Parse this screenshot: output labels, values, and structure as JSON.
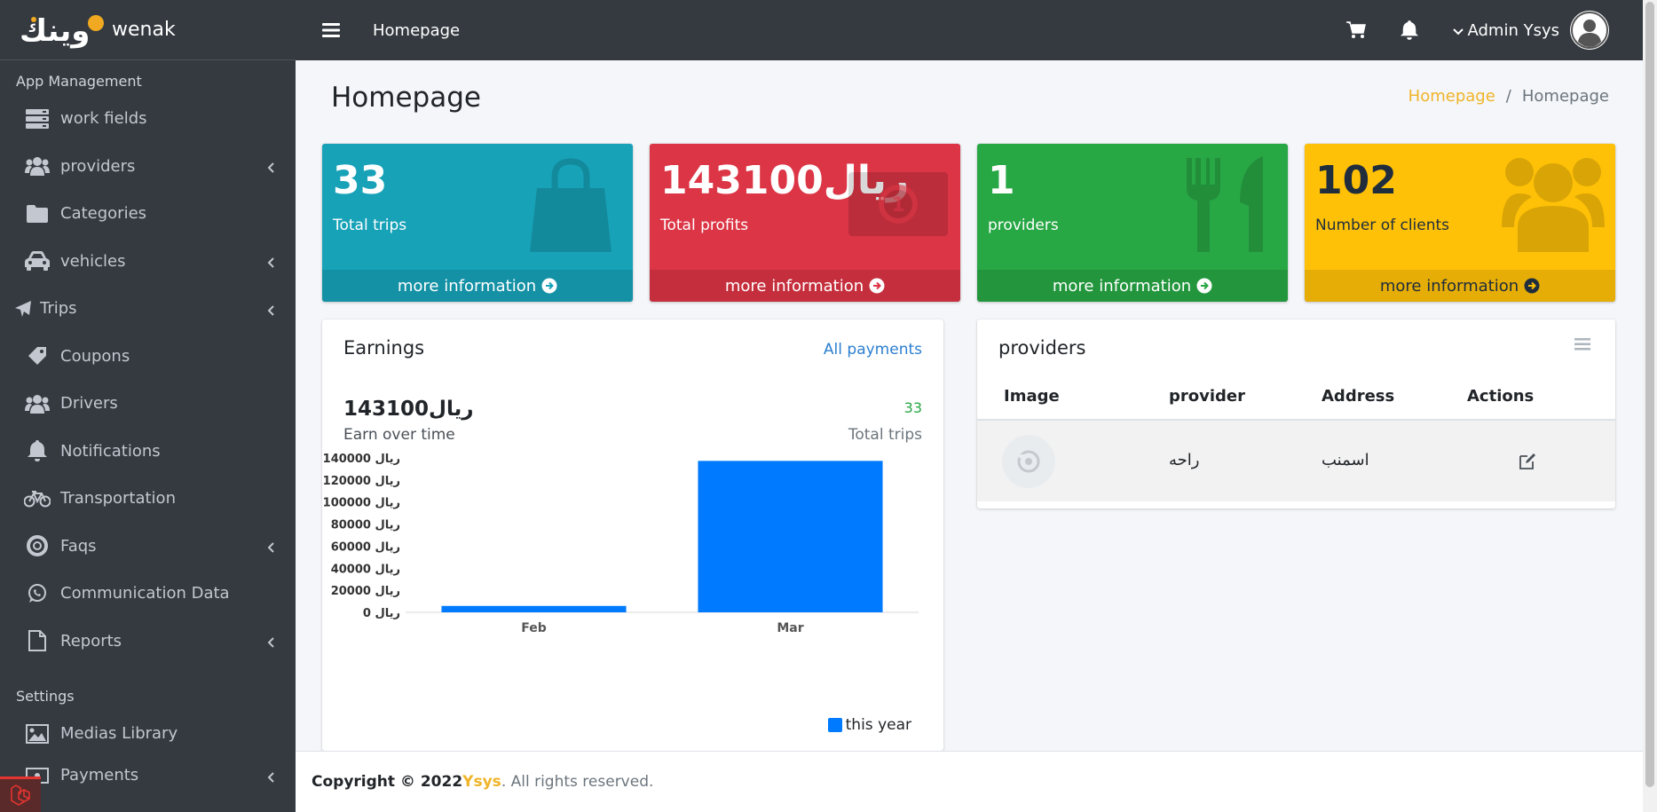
{
  "brand": {
    "logo_text": "وينك",
    "name": "wenak"
  },
  "sidebar": {
    "app_header": "App Management",
    "items": [
      {
        "label": "work fields",
        "icon": "server-icon",
        "has_caret": false
      },
      {
        "label": "providers",
        "icon": "users-icon",
        "has_caret": true
      },
      {
        "label": "Categories",
        "icon": "folder-icon",
        "has_caret": false
      },
      {
        "label": "vehicles",
        "icon": "car-icon",
        "has_caret": true
      },
      {
        "label": "Trips",
        "icon": "plane-icon",
        "has_caret": true
      },
      {
        "label": "Coupons",
        "icon": "ticket-icon",
        "has_caret": false
      },
      {
        "label": "Drivers",
        "icon": "users-icon",
        "has_caret": false
      },
      {
        "label": "Notifications",
        "icon": "bell-icon",
        "has_caret": false
      },
      {
        "label": "Transportation",
        "icon": "bicycle-icon",
        "has_caret": false
      },
      {
        "label": "Faqs",
        "icon": "life-ring-icon",
        "has_caret": true
      },
      {
        "label": "Communication Data",
        "icon": "whatsapp-icon",
        "has_caret": false
      },
      {
        "label": "Reports",
        "icon": "file-icon",
        "has_caret": true
      }
    ],
    "settings_header": "Settings",
    "settings_items": [
      {
        "label": "Medias Library",
        "icon": "image-icon",
        "has_caret": false
      },
      {
        "label": "Payments",
        "icon": "money-icon",
        "has_caret": true
      }
    ]
  },
  "topbar": {
    "title": "Homepage",
    "user_name": "Admin Ysys"
  },
  "page": {
    "title": "Homepage",
    "breadcrumb": {
      "link": "Homepage",
      "current": "Homepage"
    }
  },
  "stats": [
    {
      "value": "33",
      "label": "Total trips",
      "footer": "more information",
      "color": "#17a2b8",
      "icon": "shopping-bag-icon"
    },
    {
      "value": "143100ريال",
      "label": "Total profits",
      "footer": "more information",
      "color": "#dc3545",
      "icon": "money-bill-icon"
    },
    {
      "value": "1",
      "label": "providers",
      "footer": "more information",
      "color": "#28a745",
      "icon": "utensils-icon"
    },
    {
      "value": "102",
      "label": "Number of clients",
      "footer": "more information",
      "color": "#ffc107",
      "icon": "users-icon"
    }
  ],
  "earnings": {
    "title": "Earnings",
    "link": "All payments",
    "total": "143100ريال",
    "subtitle": "Earn over time",
    "trips_count": "33",
    "trips_label": "Total trips",
    "legend": "this year"
  },
  "chart_data": {
    "type": "bar",
    "categories": [
      "Feb",
      "Mar"
    ],
    "series": [
      {
        "name": "this year",
        "values": [
          5800,
          137300
        ],
        "color": "#007bff"
      }
    ],
    "y_ticks": [
      0,
      20000,
      40000,
      60000,
      80000,
      100000,
      120000,
      140000
    ],
    "y_tick_suffix": "ريال",
    "ylim": [
      0,
      140000
    ],
    "grid": false,
    "legend_position": "bottom-right"
  },
  "providers_card": {
    "title": "providers",
    "columns": [
      "Image",
      "provider",
      "Address",
      "Actions"
    ],
    "rows": [
      {
        "provider": "راحه",
        "address": "اسمنب"
      }
    ]
  },
  "footer": {
    "prefix": "Copyright © 2022 ",
    "brand": "Ysys",
    "suffix": ". All rights reserved."
  }
}
